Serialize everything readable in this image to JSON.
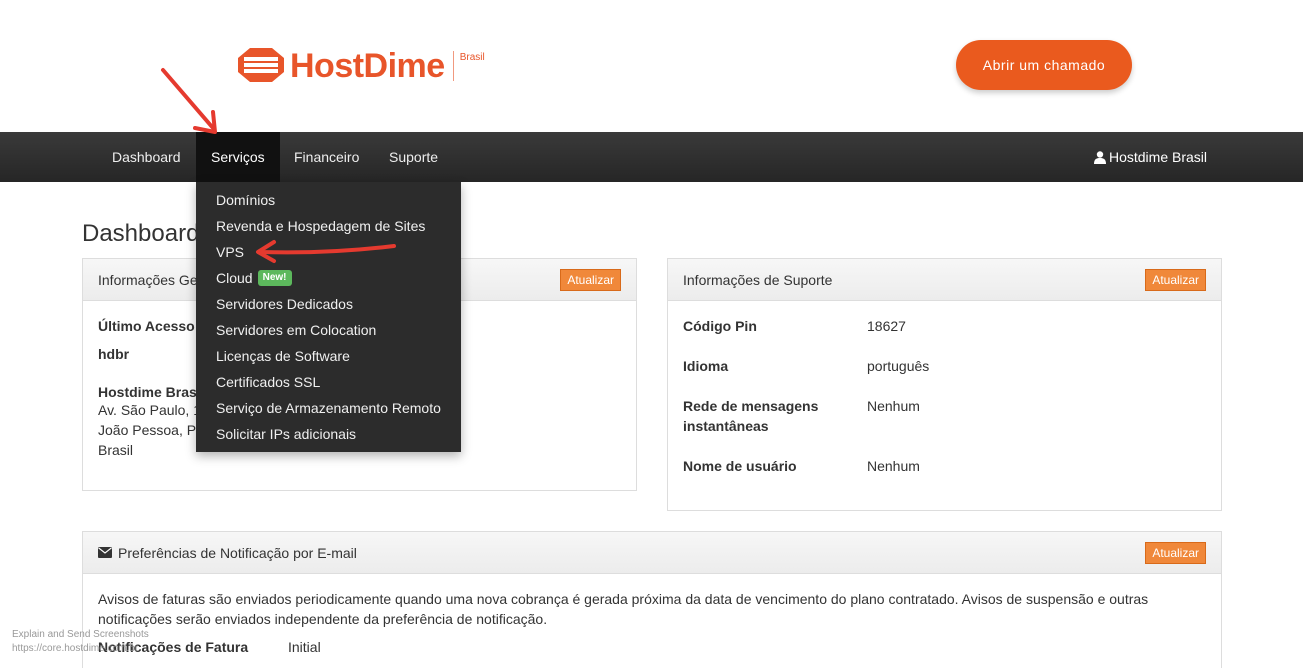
{
  "header": {
    "logo_text": "HostDime",
    "logo_sub": "Brasil",
    "cta_label": "Abrir um chamado"
  },
  "nav": {
    "items": [
      "Dashboard",
      "Serviços",
      "Financeiro",
      "Suporte"
    ],
    "active": "Serviços",
    "user_label": "Hostdime Brasil"
  },
  "dropdown": {
    "items": [
      "Domínios",
      "Revenda e Hospedagem de Sites",
      "VPS",
      "Cloud",
      "Servidores Dedicados",
      "Servidores em Colocation",
      "Licenças de Software",
      "Certificados SSL",
      "Serviço de Armazenamento Remoto",
      "Solicitar IPs adicionais"
    ],
    "cloud_badge": "New!"
  },
  "page": {
    "title": "Dashboard"
  },
  "general_panel": {
    "title": "Informações Ge",
    "update_label": "Atualizar",
    "last_access_label": "Último Acesso",
    "username": "hdbr",
    "company": "Hostdime Bras",
    "address_lines": [
      "Av. São Paulo, 1",
      "João Pessoa, P",
      "Brasil"
    ]
  },
  "support_panel": {
    "title": "Informações de Suporte",
    "update_label": "Atualizar",
    "rows": [
      {
        "label": "Código Pin",
        "value": "18627"
      },
      {
        "label": "Idioma",
        "value": "português"
      },
      {
        "label": "Rede de mensagens instantâneas",
        "value": "Nenhum"
      },
      {
        "label": "Nome de usuário",
        "value": "Nenhum"
      }
    ]
  },
  "notification_panel": {
    "title": "Preferências de Notificação por E-mail",
    "update_label": "Atualizar",
    "notice": "Avisos de faturas são enviados periodicamente quando uma nova cobrança é gerada próxima da data de vencimento do plano contratado. Avisos de suspensão e outras notificações serão enviados independente da preferência de notificação.",
    "fatura_label": "Notificações de Fatura",
    "fatura_value": "Initial"
  },
  "watermark": {
    "line1": "Explain and Send Screenshots",
    "line2": "https://core.hostdime.com.br"
  },
  "colors": {
    "brand": "#e8552a",
    "navbar": "#2b2b2b",
    "dropdown": "#2c2c2c",
    "update_button": "#f0883a",
    "badge_new": "#5cb85c",
    "annotation_arrow": "#e53a2f"
  }
}
